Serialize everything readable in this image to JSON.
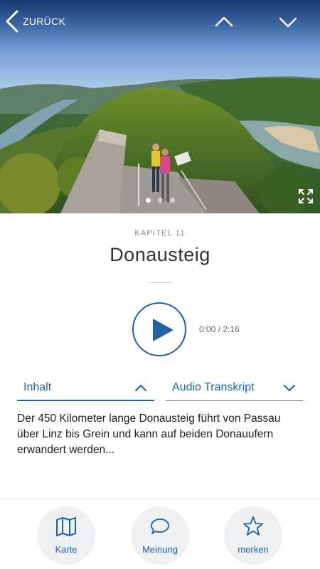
{
  "header": {
    "back_label": "ZURÜCK",
    "back_icon": "chevron-left-icon",
    "prev_icon": "chevron-up-icon",
    "next_icon": "chevron-down-icon",
    "expand_icon": "expand-icon"
  },
  "gallery": {
    "slides": 3,
    "active_slide": 1
  },
  "episode": {
    "chapter": "KAPITEL 11",
    "title": "Donausteig",
    "time": "0:00 / 2:16"
  },
  "tabs": {
    "inhalt": "Inhalt",
    "transkript": "Audio Transkript"
  },
  "content": {
    "text": "Der 450 Kilometer lange Donausteig führt von Passau über Linz bis Grein und kann auf beiden Donauufern erwandert werden..."
  },
  "bottom_bar": {
    "karte": "Karte",
    "meinung": "Meinung",
    "merken": "merken"
  },
  "colors": {
    "accent": "#1e63a8",
    "button_bg": "#eef0f2"
  }
}
